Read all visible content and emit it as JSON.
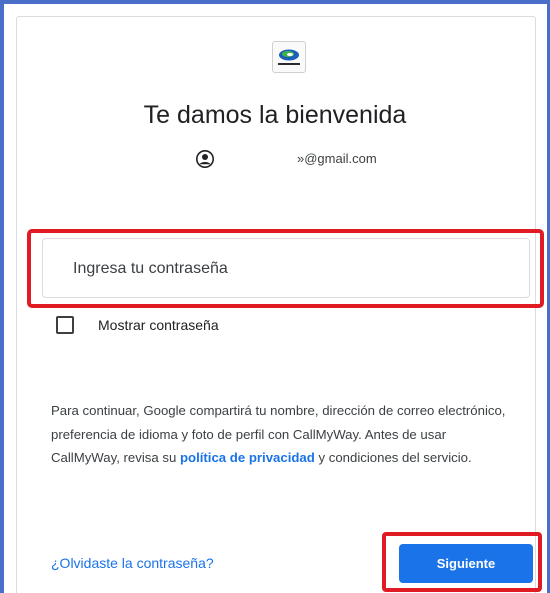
{
  "logo": {
    "icon": "callmyway-logo-icon",
    "text": "call my way"
  },
  "title": "Te damos la bienvenida",
  "account": {
    "icon": "account-circle-icon",
    "email": "»@gmail.com"
  },
  "password": {
    "placeholder": "Ingresa tu contraseña"
  },
  "show_password": {
    "label": "Mostrar contraseña",
    "checked": false
  },
  "disclaimer": {
    "text_before": "Para continuar, Google compartirá tu nombre, dirección de correo electrónico, preferencia de idioma y foto de perfil con CallMyWay. Antes de usar CallMyWay, revisa su ",
    "privacy_link": "política de privacidad",
    "text_after": " y condiciones del servicio."
  },
  "forgot_password": "¿Olvidaste la contraseña?",
  "next_button": "Siguiente",
  "colors": {
    "accent": "#1a73e8",
    "highlight": "#e01b24",
    "frame": "#4a6fc9"
  }
}
